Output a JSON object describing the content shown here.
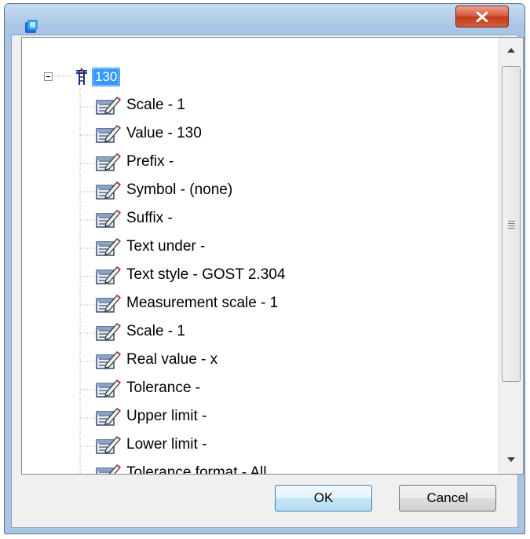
{
  "window": {
    "title": "",
    "close_label": "X",
    "app_icon": "app-icon"
  },
  "tree": {
    "root": {
      "label": "130",
      "expanded": true,
      "icon": "dimension-icon"
    },
    "items": [
      {
        "label": "Scale - 1",
        "icon": "property-icon"
      },
      {
        "label": "Value - 130",
        "icon": "property-icon"
      },
      {
        "label": "Prefix -",
        "icon": "property-icon"
      },
      {
        "label": "Symbol - (none)",
        "icon": "property-icon"
      },
      {
        "label": "Suffix -",
        "icon": "property-icon"
      },
      {
        "label": "Text under -",
        "icon": "property-icon"
      },
      {
        "label": "Text style - GOST 2.304",
        "icon": "property-icon"
      },
      {
        "label": "Measurement scale - 1",
        "icon": "property-icon"
      },
      {
        "label": "Scale - 1",
        "icon": "property-icon"
      },
      {
        "label": "Real value - x",
        "icon": "property-icon"
      },
      {
        "label": "Tolerance -",
        "icon": "property-icon"
      },
      {
        "label": "Upper limit -",
        "icon": "property-icon"
      },
      {
        "label": "Lower limit -",
        "icon": "property-icon"
      },
      {
        "label": "Tolerance format - All",
        "icon": "property-icon"
      }
    ]
  },
  "buttons": {
    "ok_label": "OK",
    "cancel_label": "Cancel"
  },
  "colors": {
    "selection": "#3399ff",
    "close_button": "#c94a2d",
    "window_frame": "#a9c4e4"
  }
}
